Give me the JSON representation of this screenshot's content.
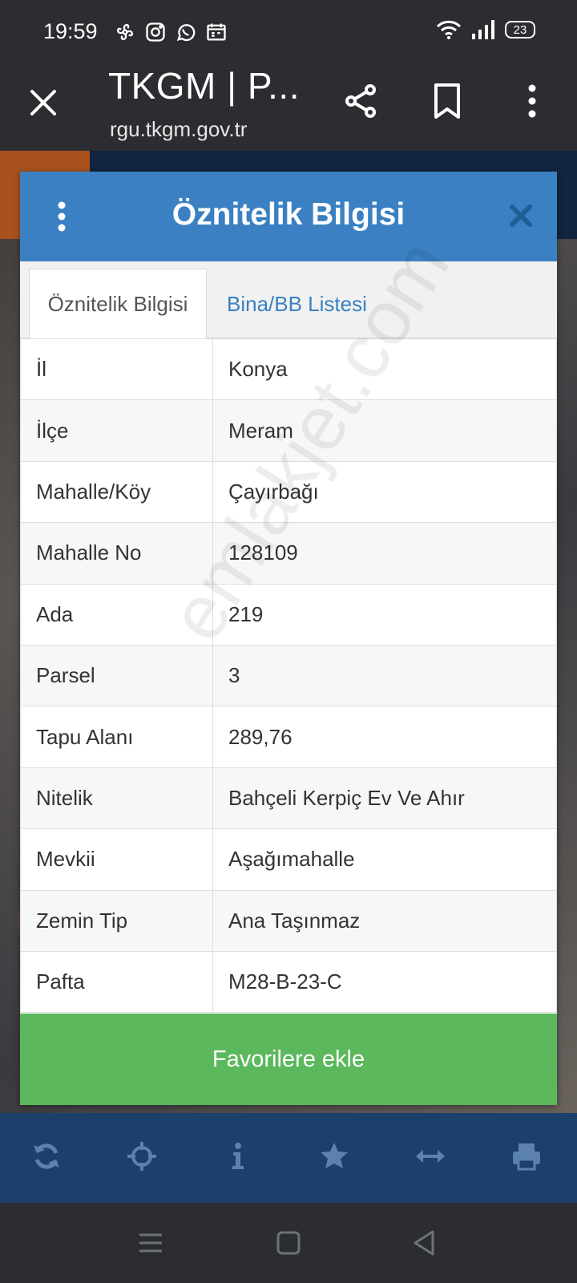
{
  "status_bar": {
    "time": "19:59",
    "battery": "23"
  },
  "browser": {
    "title": "TKGM | P...",
    "url": "rgu.tkgm.gov.tr"
  },
  "modal": {
    "title": "Öznitelik Bilgisi",
    "tabs": [
      {
        "label": "Öznitelik Bilgisi"
      },
      {
        "label": "Bina/BB Listesi"
      }
    ],
    "rows": [
      {
        "key": "İl",
        "value": "Konya"
      },
      {
        "key": "İlçe",
        "value": "Meram"
      },
      {
        "key": "Mahalle/Köy",
        "value": "Çayırbağı"
      },
      {
        "key": "Mahalle No",
        "value": "128109"
      },
      {
        "key": "Ada",
        "value": "219"
      },
      {
        "key": "Parsel",
        "value": "3"
      },
      {
        "key": "Tapu Alanı",
        "value": "289,76"
      },
      {
        "key": "Nitelik",
        "value": "Bahçeli Kerpiç Ev Ve Ahır"
      },
      {
        "key": "Mevkii",
        "value": "Aşağımahalle"
      },
      {
        "key": "Zemin Tip",
        "value": "Ana Taşınmaz"
      },
      {
        "key": "Pafta",
        "value": "M28-B-23-C"
      }
    ],
    "favorite_label": "Favorilere ekle"
  },
  "watermark": "emlakjet.com",
  "colors": {
    "header_blue": "#3a80c2",
    "button_green": "#5cb85c",
    "toolbar_navy": "#1c3f6b",
    "tab_link_blue": "#3a80c2"
  }
}
